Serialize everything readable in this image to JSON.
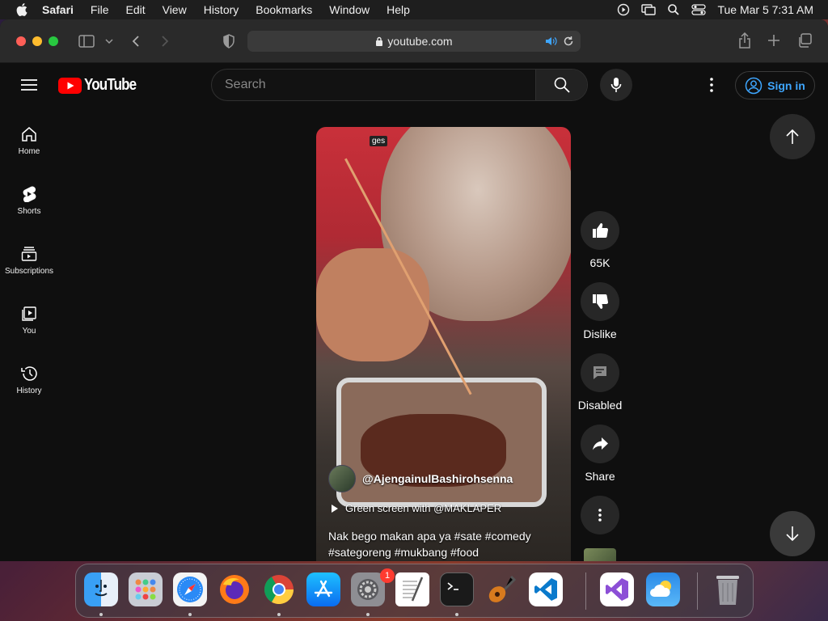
{
  "menubar": {
    "app_name": "Safari",
    "items": [
      "File",
      "Edit",
      "View",
      "History",
      "Bookmarks",
      "Window",
      "Help"
    ],
    "datetime": "Tue Mar 5  7:31 AM"
  },
  "browser": {
    "url": "youtube.com"
  },
  "youtube": {
    "logo_text": "YouTube",
    "search_placeholder": "Search",
    "sign_in_label": "Sign in",
    "accent_color": "#3ea6ff",
    "brand_color": "#ff0000",
    "sidebar": [
      {
        "label": "Home",
        "icon": "home-icon"
      },
      {
        "label": "Shorts",
        "icon": "shorts-icon"
      },
      {
        "label": "Subscriptions",
        "icon": "subscriptions-icon"
      },
      {
        "label": "You",
        "icon": "you-icon"
      },
      {
        "label": "History",
        "icon": "history-icon"
      }
    ],
    "short": {
      "overlay_tag": "ges",
      "channel": "@AjengainulBashirohsenna",
      "sound": "Green screen with @MAKLAPER",
      "caption": "Nak bego makan apa ya #sate #comedy #sategoreng #mukbang #food"
    },
    "actions": {
      "like_count": "65K",
      "dislike_label": "Dislike",
      "comments_label": "Disabled",
      "share_label": "Share"
    }
  },
  "dock": {
    "apps": [
      "Finder",
      "Launchpad",
      "Safari",
      "Firefox",
      "Chrome",
      "App Store",
      "System Settings",
      "TextEdit",
      "Terminal",
      "GarageBand",
      "VS Code",
      "Visual Studio",
      "Weather",
      "Trash"
    ],
    "settings_badge": "1"
  }
}
